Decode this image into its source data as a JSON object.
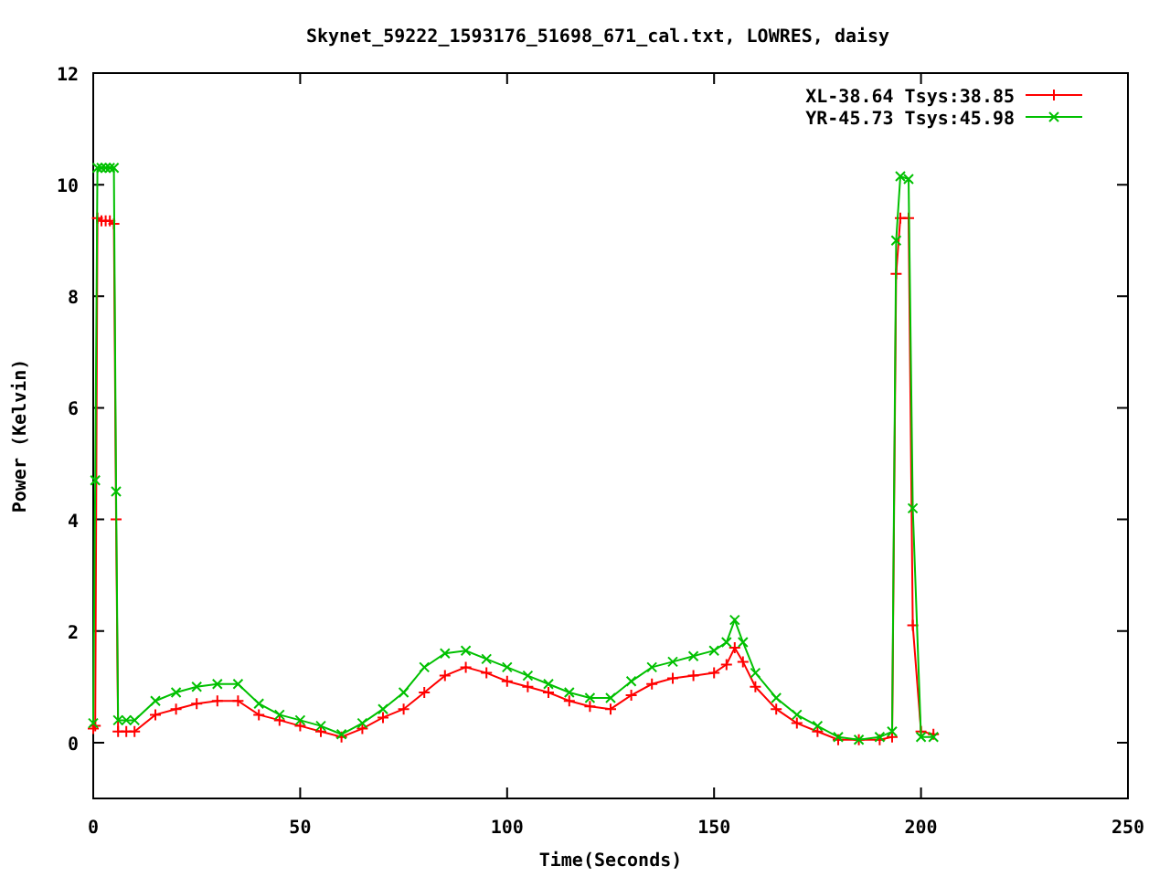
{
  "chart_data": {
    "type": "line",
    "title": "Skynet_59222_1593176_51698_671_cal.txt, LOWRES, daisy",
    "xlabel": "Time(Seconds)",
    "ylabel": "Power (Kelvin)",
    "x": [
      0,
      0.5,
      1,
      2,
      3,
      4,
      5,
      5.5,
      6,
      8,
      10,
      15,
      20,
      25,
      30,
      35,
      40,
      45,
      50,
      55,
      60,
      65,
      70,
      75,
      80,
      85,
      90,
      95,
      100,
      105,
      110,
      115,
      120,
      125,
      130,
      135,
      140,
      145,
      150,
      153,
      155,
      157,
      160,
      165,
      170,
      175,
      180,
      185,
      190,
      193,
      194,
      195,
      197,
      198,
      200,
      203
    ],
    "series": [
      {
        "name": "XL-38.64 Tsys:38.85",
        "color": "#ff0000",
        "values": [
          0.25,
          0.3,
          9.4,
          9.35,
          9.35,
          9.35,
          9.3,
          4.0,
          0.2,
          0.2,
          0.2,
          0.5,
          0.6,
          0.7,
          0.75,
          0.75,
          0.5,
          0.4,
          0.3,
          0.2,
          0.1,
          0.25,
          0.45,
          0.6,
          0.9,
          1.2,
          1.35,
          1.25,
          1.1,
          1.0,
          0.9,
          0.75,
          0.65,
          0.6,
          0.85,
          1.05,
          1.15,
          1.2,
          1.25,
          1.4,
          1.7,
          1.45,
          1.0,
          0.6,
          0.35,
          0.2,
          0.05,
          0.05,
          0.05,
          0.1,
          8.4,
          9.4,
          9.4,
          2.1,
          0.2,
          0.15
        ]
      },
      {
        "name": "YR-45.73 Tsys:45.98",
        "color": "#00c000",
        "values": [
          0.35,
          4.7,
          10.3,
          10.3,
          10.3,
          10.3,
          10.3,
          4.5,
          0.4,
          0.4,
          0.4,
          0.75,
          0.9,
          1.0,
          1.05,
          1.05,
          0.7,
          0.5,
          0.4,
          0.3,
          0.15,
          0.35,
          0.6,
          0.9,
          1.35,
          1.6,
          1.65,
          1.5,
          1.35,
          1.2,
          1.05,
          0.9,
          0.8,
          0.8,
          1.1,
          1.35,
          1.45,
          1.55,
          1.65,
          1.8,
          2.2,
          1.8,
          1.25,
          0.8,
          0.5,
          0.3,
          0.1,
          0.05,
          0.1,
          0.2,
          9.0,
          10.15,
          10.1,
          4.2,
          0.1,
          0.1
        ]
      }
    ],
    "legend": true,
    "xlim": [
      0,
      250
    ],
    "ylim": [
      -1,
      12
    ],
    "xticks": [
      0,
      50,
      100,
      150,
      200,
      250
    ],
    "yticks": [
      0,
      2,
      4,
      6,
      8,
      10,
      12
    ]
  }
}
